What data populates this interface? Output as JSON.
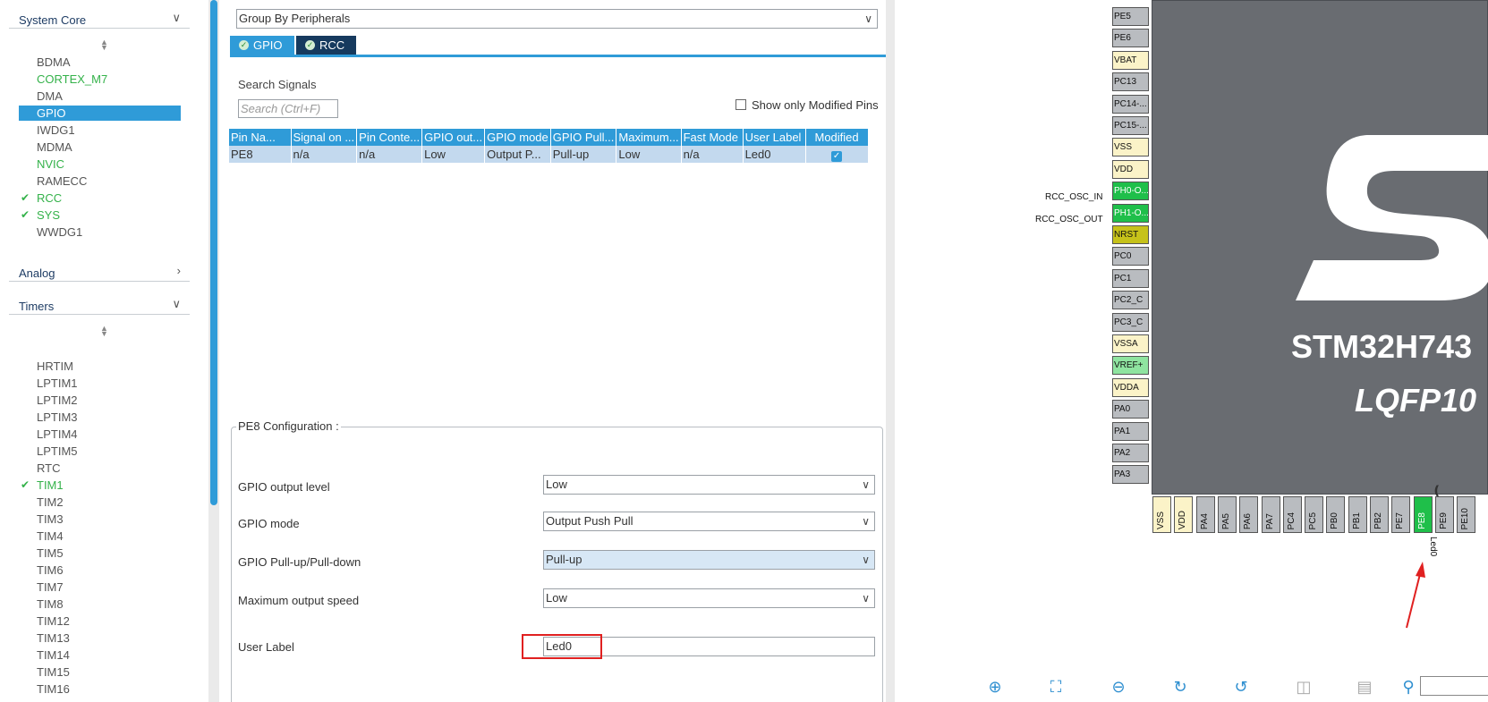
{
  "left_panel": {
    "system_core": {
      "title": "System Core",
      "items": [
        {
          "label": "BDMA",
          "state": "normal"
        },
        {
          "label": "CORTEX_M7",
          "state": "ok"
        },
        {
          "label": "DMA",
          "state": "normal"
        },
        {
          "label": "GPIO",
          "state": "selected"
        },
        {
          "label": "IWDG1",
          "state": "normal"
        },
        {
          "label": "MDMA",
          "state": "normal"
        },
        {
          "label": "NVIC",
          "state": "ok"
        },
        {
          "label": "RAMECC",
          "state": "normal"
        },
        {
          "label": "RCC",
          "state": "checked"
        },
        {
          "label": "SYS",
          "state": "checked"
        },
        {
          "label": "WWDG1",
          "state": "normal"
        }
      ]
    },
    "analog": {
      "title": "Analog"
    },
    "timers": {
      "title": "Timers",
      "items": [
        {
          "label": "HRTIM",
          "state": "normal"
        },
        {
          "label": "LPTIM1",
          "state": "normal"
        },
        {
          "label": "LPTIM2",
          "state": "normal"
        },
        {
          "label": "LPTIM3",
          "state": "normal"
        },
        {
          "label": "LPTIM4",
          "state": "normal"
        },
        {
          "label": "LPTIM5",
          "state": "normal"
        },
        {
          "label": "RTC",
          "state": "normal"
        },
        {
          "label": "TIM1",
          "state": "checked"
        },
        {
          "label": "TIM2",
          "state": "normal"
        },
        {
          "label": "TIM3",
          "state": "normal"
        },
        {
          "label": "TIM4",
          "state": "normal"
        },
        {
          "label": "TIM5",
          "state": "normal"
        },
        {
          "label": "TIM6",
          "state": "normal"
        },
        {
          "label": "TIM7",
          "state": "normal"
        },
        {
          "label": "TIM8",
          "state": "normal"
        },
        {
          "label": "TIM12",
          "state": "normal"
        },
        {
          "label": "TIM13",
          "state": "normal"
        },
        {
          "label": "TIM14",
          "state": "normal"
        },
        {
          "label": "TIM15",
          "state": "normal"
        },
        {
          "label": "TIM16",
          "state": "normal"
        }
      ]
    }
  },
  "config_panel": {
    "group_by": "Group By Peripherals",
    "tabs": [
      {
        "label": "GPIO"
      },
      {
        "label": "RCC"
      }
    ],
    "search_label": "Search Signals",
    "search_placeholder": "Search (Ctrl+F)",
    "show_modified_label": "Show only Modified Pins",
    "table": {
      "headers": [
        "Pin Na...",
        "Signal on ...",
        "Pin Conte...",
        "GPIO out...",
        "GPIO mode",
        "GPIO Pull...",
        "Maximum...",
        "Fast Mode",
        "User Label",
        "Modified"
      ],
      "rows": [
        [
          "PE8",
          "n/a",
          "n/a",
          "Low",
          "Output P...",
          "Pull-up",
          "Low",
          "n/a",
          "Led0",
          ""
        ]
      ]
    },
    "pin_config": {
      "title": "PE8 Configuration :",
      "fields": [
        {
          "label": "GPIO output level",
          "value": "Low"
        },
        {
          "label": "GPIO mode",
          "value": "Output Push Pull"
        },
        {
          "label": "GPIO Pull-up/Pull-down",
          "value": "Pull-up"
        },
        {
          "label": "Maximum output speed",
          "value": "Low"
        }
      ],
      "user_label": {
        "label": "User Label",
        "value": "Led0"
      }
    }
  },
  "chip_view": {
    "chip_name": "STM32H743",
    "package": "LQFP10",
    "left_pins": [
      {
        "label": "PE5",
        "color": "grey"
      },
      {
        "label": "PE6",
        "color": "grey"
      },
      {
        "label": "VBAT",
        "color": "yellow"
      },
      {
        "label": "PC13",
        "color": "grey"
      },
      {
        "label": "PC14-...",
        "color": "grey"
      },
      {
        "label": "PC15-...",
        "color": "grey"
      },
      {
        "label": "VSS",
        "color": "yellow"
      },
      {
        "label": "VDD",
        "color": "yellow"
      },
      {
        "label": "PH0-O...",
        "color": "green"
      },
      {
        "label": "PH1-O...",
        "color": "green"
      },
      {
        "label": "NRST",
        "color": "olive"
      },
      {
        "label": "PC0",
        "color": "grey"
      },
      {
        "label": "PC1",
        "color": "grey"
      },
      {
        "label": "PC2_C",
        "color": "grey"
      },
      {
        "label": "PC3_C",
        "color": "grey"
      },
      {
        "label": "VSSA",
        "color": "yellow"
      },
      {
        "label": "VREF+",
        "color": "lightgreen"
      },
      {
        "label": "VDDA",
        "color": "yellow"
      },
      {
        "label": "PA0",
        "color": "grey"
      },
      {
        "label": "PA1",
        "color": "grey"
      },
      {
        "label": "PA2",
        "color": "grey"
      },
      {
        "label": "PA3",
        "color": "grey"
      }
    ],
    "signal_labels": {
      "ph0": "RCC_OSC_IN",
      "ph1": "RCC_OSC_OUT"
    },
    "bottom_pins": [
      {
        "label": "VSS",
        "color": "yellow"
      },
      {
        "label": "VDD",
        "color": "yellow"
      },
      {
        "label": "PA4",
        "color": "grey"
      },
      {
        "label": "PA5",
        "color": "grey"
      },
      {
        "label": "PA6",
        "color": "grey"
      },
      {
        "label": "PA7",
        "color": "grey"
      },
      {
        "label": "PC4",
        "color": "grey"
      },
      {
        "label": "PC5",
        "color": "grey"
      },
      {
        "label": "PB0",
        "color": "grey"
      },
      {
        "label": "PB1",
        "color": "grey"
      },
      {
        "label": "PB2",
        "color": "grey"
      },
      {
        "label": "PE7",
        "color": "grey"
      },
      {
        "label": "PE8",
        "color": "green"
      },
      {
        "label": "PE9",
        "color": "grey"
      },
      {
        "label": "PE10",
        "color": "grey"
      }
    ],
    "pe8_user_label": "Led0",
    "toolbar_icons": [
      "zoom-in-icon",
      "fit-screen-icon",
      "zoom-out-icon",
      "rotate-right-icon",
      "rotate-left-icon",
      "flip-vertical-icon",
      "flip-horizontal-icon",
      "search-icon"
    ]
  }
}
